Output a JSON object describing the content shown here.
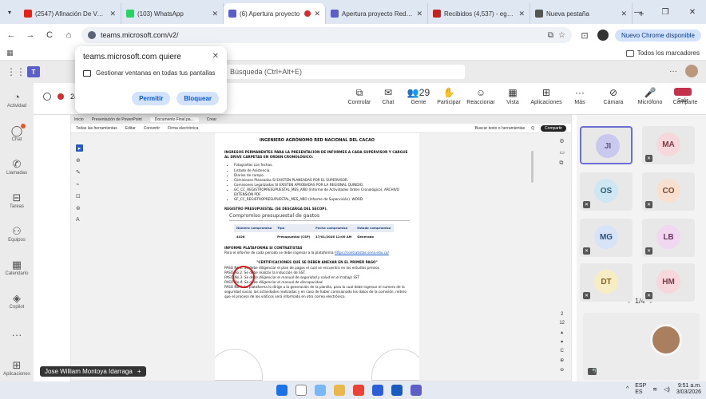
{
  "browser": {
    "tabs": [
      {
        "title": "(2547) Afinación De Voz C:",
        "icon_color": "#e62117"
      },
      {
        "title": "(103) WhatsApp",
        "icon_color": "#25d366"
      },
      {
        "title": "(6) Apertura proyecto",
        "icon_color": "#5b5fc7",
        "recording": true
      },
      {
        "title": "Apertura proyecto Red Na",
        "icon_color": "#5b5fc7"
      },
      {
        "title": "Recibidos (4,537) - egelve",
        "icon_color": "#c5221f"
      },
      {
        "title": "Nueva pestaña",
        "icon_color": "#555555"
      }
    ],
    "url": "teams.microsoft.com/v2/",
    "update_label": "Nuevo Chrome disponible",
    "bookmarks_folder": "Todos los marcadores"
  },
  "permission_popup": {
    "title": "teams.microsoft.com quiere",
    "request": "Gestionar ventanas en todas tus pantallas",
    "allow_label": "Permitir",
    "block_label": "Bloquear"
  },
  "teams": {
    "search_placeholder": "Búsqueda (Ctrl+Alt+E)",
    "rail": [
      {
        "label": "Actividad",
        "icon": "bell-icon"
      },
      {
        "label": "Chat",
        "icon": "chat-icon",
        "badge": true
      },
      {
        "label": "Llamadas",
        "icon": "phone-icon"
      },
      {
        "label": "Tareas",
        "icon": "tasks-icon"
      },
      {
        "label": "Equipos",
        "icon": "teams-icon"
      },
      {
        "label": "Calendario",
        "icon": "calendar-icon"
      },
      {
        "label": "Copilot",
        "icon": "copilot-icon"
      },
      {
        "label": "...",
        "icon": "more-icon"
      },
      {
        "label": "Aplicaciones",
        "icon": "apps-icon"
      }
    ],
    "meeting_timer": "24",
    "controls": [
      {
        "label": "Controlar",
        "glyph": "⧉"
      },
      {
        "label": "Chat",
        "glyph": "✉"
      },
      {
        "label": "Gente",
        "glyph": "👥",
        "count": "29"
      },
      {
        "label": "Participar",
        "glyph": "✋"
      },
      {
        "label": "Reaccionar",
        "glyph": "☺"
      },
      {
        "label": "Vista",
        "glyph": "▦"
      },
      {
        "label": "Aplicaciones",
        "glyph": "⊞"
      },
      {
        "label": "Más",
        "glyph": "···"
      },
      {
        "label": "Cámara",
        "glyph": "⊘"
      },
      {
        "label": "Micrófono",
        "glyph": "🎤"
      },
      {
        "label": "Comparte",
        "glyph": "⇪"
      }
    ],
    "leave_label": "Salir",
    "presenter_name": "Jose William Montoya Idarraga"
  },
  "shared_doc": {
    "pdf_tabs": [
      "Inicio",
      "Presentación de PowerPoint",
      "Documento Final.pa...",
      "Crear"
    ],
    "pdf_menu": [
      "Todas las herramientas",
      "Editar",
      "Convertir",
      "Firma electrónica"
    ],
    "pdf_search": "Buscar texto o herramientas",
    "pdf_share": "Compartir",
    "heading": "INGENIERO AGRÓNOMO RED NACIONAL DEL CACAO",
    "intro": "INGRESOS PERMANENTES PARA LA PRESENTACIÓN DE INFORMES A CADA SUPERVISOR Y CARGUE AL DRIVE CARPETAS EN ORDEN CRONOLÓGICO:",
    "bullets": [
      "Fotografías con fechas.",
      "Listado de Asistencia.",
      "Diarios de campo.",
      "Comisiones Planeadas  SI EXISTEN PLANEADAS POR EL SUPERVISOR.",
      "Comisiones Legalizadas SI EXISTEN APROBADAS POR LA REGIONAL QUINDIO.",
      "GC_CC_REGISTROPRESUPUESTAL_MES_AÑO (Informe de Actividades Orden Cronológico).            ARCHIVO EXTENSIÓN PDF.",
      "GF_CC_REGISTROPRESUPUESTAL_MES_AÑO (Informe de Supervisión). WORD."
    ],
    "registro_heading": "REGISTRO PRESUPUESTAL (SE DESCARGA DEL SECOP).",
    "boxed_title": "Compromiso presupuestal de gastos",
    "table_headers": [
      "Número compromiso",
      "Tipo",
      "Fecha compromiso",
      "Estado compromiso"
    ],
    "table_row": [
      "4426",
      "Presupuestal (CSP)",
      "17/01/2026 12:00 AM",
      "Generado"
    ],
    "informe_heading": "INFORME PLATAFORMA SI CONTRATISTAS",
    "informe_text": "Para el informe de cada periodo se debe ingresar a la plataforma",
    "informe_link": "https://contratistas.sena.edu.co/",
    "cert_heading": "\"CERTIFICACIONES QUE SE DEBEN ANEXAR EN EL PRIMER PAGO\"",
    "pasos": [
      "PASO No.1. Se debe diligenciar el plan de pagos el cual se encuentra en los estudios previos",
      "PASO No.2. Se debe realizar la inducción de SST.",
      "PASO No.3. Se debe diligenciar el manual de seguridad y salud en el trabajo SST",
      "PASO No.4. Se debe diligenciar el manual de discapacidad.",
      "PASO No.4. La plataforma lo dirige a la generación de la planilla, para lo cual debe ingresar el numero de la seguridad social, las actividades realizadas y en caso de haber comisionado los datos de la comisión, reitero que el proceso de los viáticos será informado en otro correo electrónico."
    ],
    "page_numbers": [
      "2",
      "12"
    ]
  },
  "participants": [
    {
      "initials": "JI",
      "color": "#c9c9ef",
      "text": "#5a5a7a",
      "focus": true
    },
    {
      "initials": "MA",
      "color": "#f6d7dc",
      "text": "#7a3d49"
    },
    {
      "initials": "OS",
      "color": "#cfe6f3",
      "text": "#2f5a73"
    },
    {
      "initials": "CO",
      "color": "#f7e0d0",
      "text": "#7a4a2f"
    },
    {
      "initials": "MG",
      "color": "#d7e4f7",
      "text": "#2f4f7a"
    },
    {
      "initials": "LB",
      "color": "#f1d7ef",
      "text": "#6e3468"
    },
    {
      "initials": "DT",
      "color": "#f7edc5",
      "text": "#7a6220"
    },
    {
      "initials": "HM",
      "color": "#f6d7dc",
      "text": "#7a3d49"
    }
  ],
  "gallery_pager": "1/4",
  "taskbar": {
    "lang": "ESP",
    "lang2": "ES",
    "time": "9:51 a.m.",
    "date": "3/03/2026"
  }
}
